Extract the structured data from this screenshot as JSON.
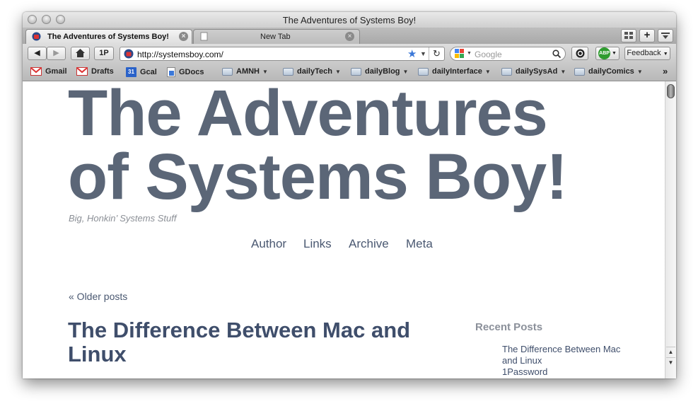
{
  "window": {
    "title": "The Adventures of Systems Boy!"
  },
  "tabs": [
    {
      "label": "The Adventures of Systems Boy!",
      "active": true
    },
    {
      "label": "New Tab",
      "active": false
    }
  ],
  "toolbar": {
    "onepassword_label": "1P",
    "url": "http://systemsboy.com/",
    "search_placeholder": "Google",
    "abp_label": "ABP",
    "feedback_label": "Feedback"
  },
  "bookmarks": [
    {
      "label": "Gmail",
      "icon": "gmail-icon"
    },
    {
      "label": "Drafts",
      "icon": "gmail-icon"
    },
    {
      "label": "Gcal",
      "icon": "calendar-icon",
      "badge": "31"
    },
    {
      "label": "GDocs",
      "icon": "docs-icon"
    },
    {
      "label": "AMNH",
      "icon": "folder-icon"
    },
    {
      "label": "dailyTech",
      "icon": "folder-icon"
    },
    {
      "label": "dailyBlog",
      "icon": "folder-icon"
    },
    {
      "label": "dailyInterface",
      "icon": "folder-icon"
    },
    {
      "label": "dailySysAd",
      "icon": "folder-icon"
    },
    {
      "label": "dailyComics",
      "icon": "folder-icon"
    }
  ],
  "overflow_label": "»",
  "page": {
    "title_line1": "The Adventures",
    "title_line2": "of Systems Boy!",
    "tagline": "Big, Honkin’ Systems Stuff",
    "nav": [
      "Author",
      "Links",
      "Archive",
      "Meta"
    ],
    "older_posts": "« Older posts",
    "post_title": "The Difference Between Mac and Linux",
    "sidebar_heading": "Recent Posts",
    "recent_posts": [
      "The Difference Between Mac and Linux",
      "1Password"
    ]
  },
  "colors": {
    "title": "#5b6677",
    "link": "#3f4e6b",
    "accent_abp": "#2e9b2e"
  }
}
